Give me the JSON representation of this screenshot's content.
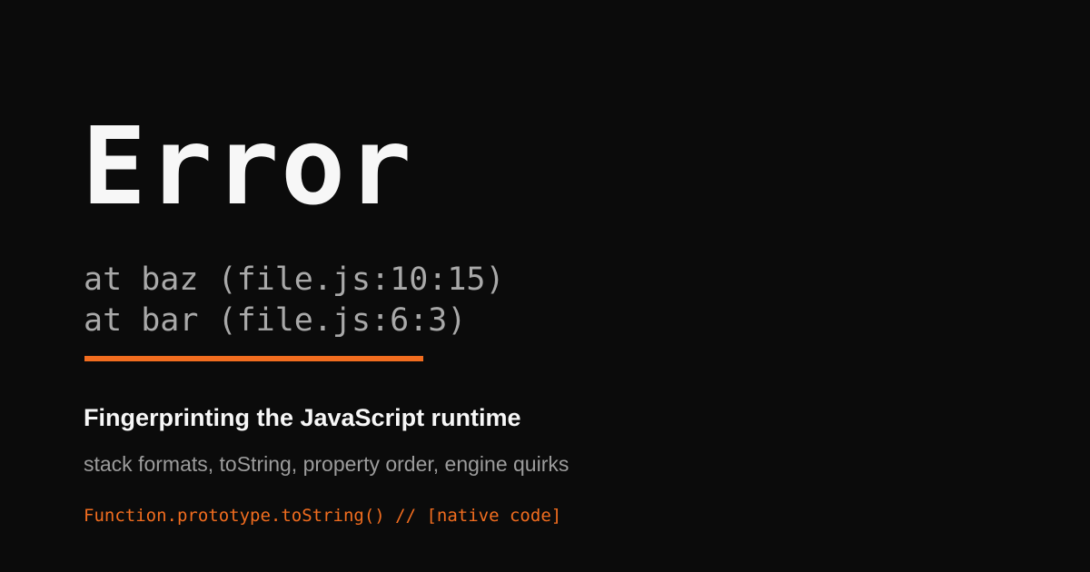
{
  "heading": "Error",
  "stack_trace": {
    "lines": [
      "at baz (file.js:10:15)",
      "at bar (file.js:6:3)"
    ]
  },
  "title": "Fingerprinting the JavaScript runtime",
  "subtitle": "stack formats, toString, property order, engine quirks",
  "code_snippet": "Function.prototype.toString() // [native code]",
  "colors": {
    "background": "#0b0b0b",
    "heading": "#f7f7f7",
    "stack_text": "#a9a9a9",
    "accent": "#f26d1f",
    "subtitle": "#9c9c9c"
  }
}
